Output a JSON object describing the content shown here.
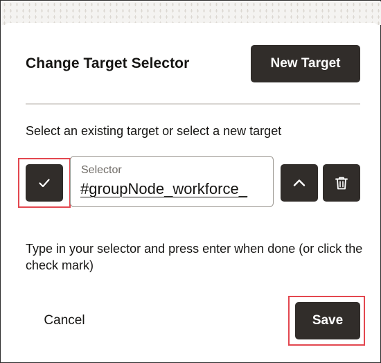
{
  "dialog": {
    "title": "Change Target Selector",
    "new_target_label": "New Target",
    "instruction": "Select an existing target or select a new target",
    "selector": {
      "label": "Selector",
      "value": "#groupNode_workforce_"
    },
    "help_text": "Type in your selector and press enter when done (or click the check mark)",
    "cancel_label": "Cancel",
    "save_label": "Save"
  },
  "icons": {
    "confirm": "check-icon",
    "move_up": "chevron-up-icon",
    "delete": "trash-icon"
  },
  "colors": {
    "button_dark": "#312d2a",
    "highlight": "#e3474f",
    "divider": "#d9d6d2",
    "text": "#161513"
  }
}
